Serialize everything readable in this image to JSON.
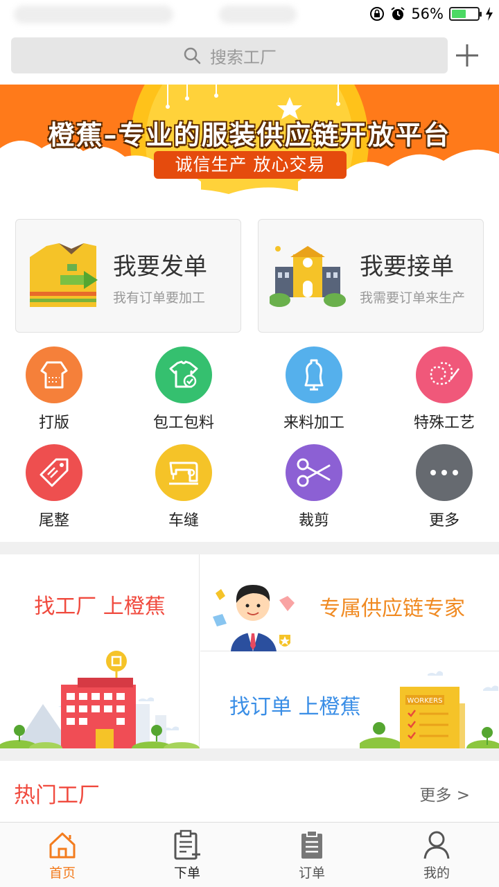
{
  "status_bar": {
    "battery": "56%"
  },
  "search": {
    "placeholder": "搜索工厂"
  },
  "banner": {
    "title": "橙蕉–专业的服装供应链开放平台",
    "subtitle": "诚信生产 放心交易"
  },
  "cards": [
    {
      "title": "我要发单",
      "subtitle": "我有订单要加工"
    },
    {
      "title": "我要接单",
      "subtitle": "我需要订单来生产"
    }
  ],
  "categories": [
    {
      "label": "打版",
      "color": "#f5803a",
      "icon": "pattern-shirt-icon"
    },
    {
      "label": "包工包料",
      "color": "#35c06f",
      "icon": "tshirt-check-icon"
    },
    {
      "label": "来料加工",
      "color": "#55b0ec",
      "icon": "mannequin-icon"
    },
    {
      "label": "特殊工艺",
      "color": "#f0587a",
      "icon": "embroidery-icon"
    },
    {
      "label": "尾整",
      "color": "#ee4f4f",
      "icon": "tag-icon"
    },
    {
      "label": "车缝",
      "color": "#f5c328",
      "icon": "sewing-machine-icon"
    },
    {
      "label": "裁剪",
      "color": "#8c60d4",
      "icon": "scissors-icon"
    },
    {
      "label": "更多",
      "color": "#666a70",
      "icon": "more-dots-icon"
    }
  ],
  "promo": {
    "left_title": "找工厂 上橙蕉",
    "right_top_title": "专属供应链专家",
    "right_bottom_title": "找订单 上橙蕉",
    "workers_sign": "WORKERS"
  },
  "hot_factories": {
    "title": "热门工厂",
    "more": "更多 >"
  },
  "tabbar": {
    "active_color": "#f37c1e",
    "items": [
      {
        "label": "首页",
        "icon": "home-icon",
        "active": true
      },
      {
        "label": "下单",
        "icon": "clipboard-add-icon",
        "active": false
      },
      {
        "label": "订单",
        "icon": "clipboard-list-icon",
        "active": false
      },
      {
        "label": "我的",
        "icon": "user-icon",
        "active": false
      }
    ]
  }
}
